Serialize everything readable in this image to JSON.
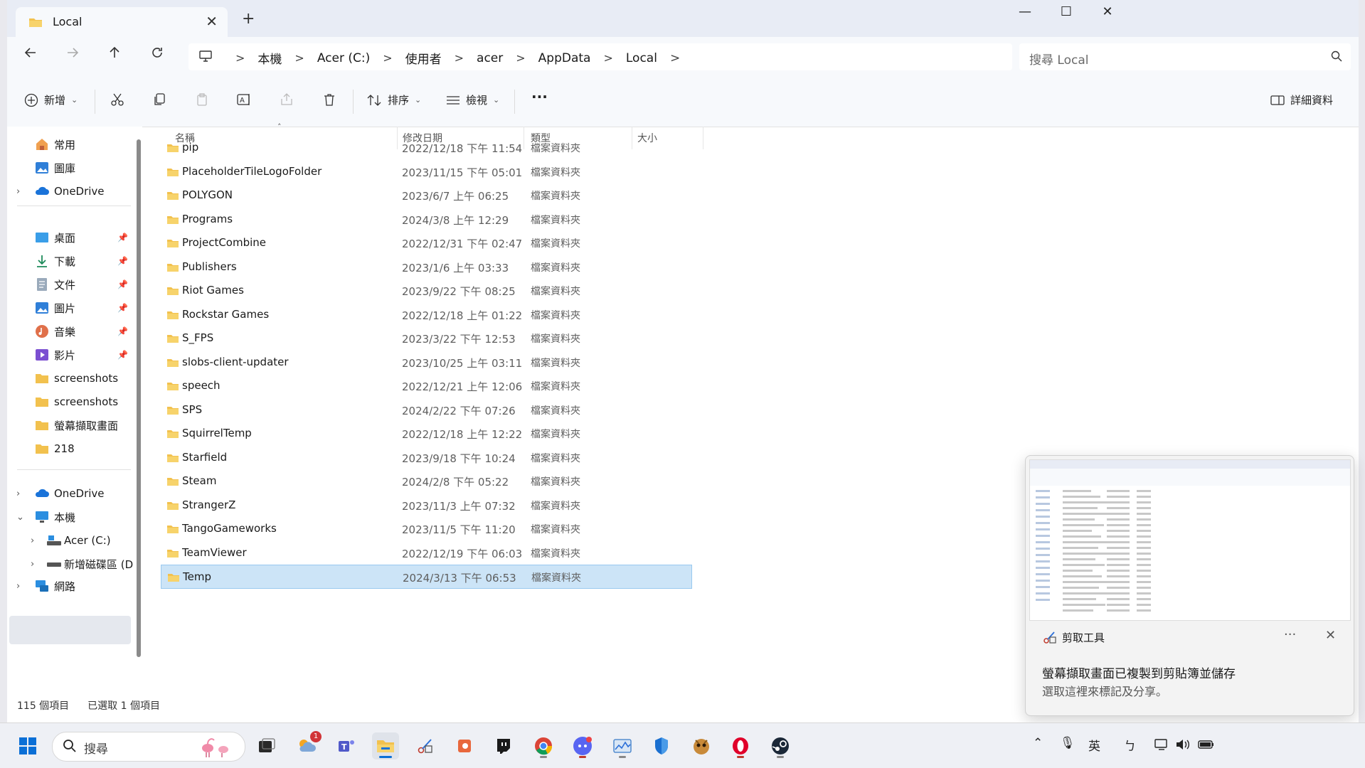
{
  "window": {
    "tab_title": "Local",
    "new_tab": "+",
    "minimize": "—",
    "maximize": "☐",
    "close": "✕"
  },
  "address": {
    "crumbs": [
      "本機",
      "Acer (C:)",
      "使用者",
      "acer",
      "AppData",
      "Local"
    ],
    "search_placeholder": "搜尋 Local"
  },
  "toolbar": {
    "new_label": "新增",
    "sort_label": "排序",
    "view_label": "檢視",
    "more_label": "···",
    "details_label": "詳細資料"
  },
  "columns": {
    "name": "名稱",
    "date": "修改日期",
    "type": "類型",
    "size": "大小"
  },
  "nav": {
    "home": "常用",
    "gallery": "圖庫",
    "onedrive_top": "OneDrive",
    "desktop": "桌面",
    "downloads": "下載",
    "documents": "文件",
    "pictures": "圖片",
    "music": "音樂",
    "videos": "影片",
    "screenshots1": "screenshots",
    "screenshots2": "screenshots",
    "capture": "螢幕擷取畫面",
    "f218": "218",
    "onedrive": "OneDrive",
    "thispc": "本機",
    "acer": "Acer (C:)",
    "newvol": "新增磁碟區 (D",
    "network": "網路"
  },
  "files": [
    {
      "name": "pip",
      "date": "2022/12/18 下午 11:54",
      "type": "檔案資料夾"
    },
    {
      "name": "PlaceholderTileLogoFolder",
      "date": "2023/11/15 下午 05:01",
      "type": "檔案資料夾"
    },
    {
      "name": "POLYGON",
      "date": "2023/6/7 上午 06:25",
      "type": "檔案資料夾"
    },
    {
      "name": "Programs",
      "date": "2024/3/8 上午 12:29",
      "type": "檔案資料夾"
    },
    {
      "name": "ProjectCombine",
      "date": "2022/12/31 下午 02:47",
      "type": "檔案資料夾"
    },
    {
      "name": "Publishers",
      "date": "2023/1/6 上午 03:33",
      "type": "檔案資料夾"
    },
    {
      "name": "Riot Games",
      "date": "2023/9/22 下午 08:25",
      "type": "檔案資料夾"
    },
    {
      "name": "Rockstar Games",
      "date": "2022/12/18 上午 01:22",
      "type": "檔案資料夾"
    },
    {
      "name": "S_FPS",
      "date": "2023/3/22 下午 12:53",
      "type": "檔案資料夾"
    },
    {
      "name": "slobs-client-updater",
      "date": "2023/10/25 上午 03:11",
      "type": "檔案資料夾"
    },
    {
      "name": "speech",
      "date": "2022/12/21 上午 12:06",
      "type": "檔案資料夾"
    },
    {
      "name": "SPS",
      "date": "2024/2/22 下午 07:26",
      "type": "檔案資料夾"
    },
    {
      "name": "SquirrelTemp",
      "date": "2022/12/18 上午 12:22",
      "type": "檔案資料夾"
    },
    {
      "name": "Starfield",
      "date": "2023/9/18 下午 10:24",
      "type": "檔案資料夾"
    },
    {
      "name": "Steam",
      "date": "2024/2/8 下午 05:22",
      "type": "檔案資料夾"
    },
    {
      "name": "StrangerZ",
      "date": "2023/11/3 上午 07:32",
      "type": "檔案資料夾"
    },
    {
      "name": "TangoGameworks",
      "date": "2023/11/5 下午 11:20",
      "type": "檔案資料夾"
    },
    {
      "name": "TeamViewer",
      "date": "2022/12/19 下午 06:03",
      "type": "檔案資料夾"
    },
    {
      "name": "Temp",
      "date": "2024/3/13 下午 06:53",
      "type": "檔案資料夾"
    }
  ],
  "status": {
    "count": "115 個項目",
    "selected": "已選取 1 個項目"
  },
  "toast": {
    "app_name": "剪取工具",
    "more": "···",
    "close": "✕",
    "line1": "螢幕擷取畫面已複製到剪貼簿並儲存",
    "line2": "選取這裡來標記及分享。"
  },
  "taskbar": {
    "search_placeholder": "搜尋",
    "weather_badge": "1",
    "lang": "英",
    "ime": "ㄅ"
  },
  "colors": {
    "accent": "#0067c0",
    "selection": "#cce4f7",
    "folder": "#f2c14e"
  }
}
